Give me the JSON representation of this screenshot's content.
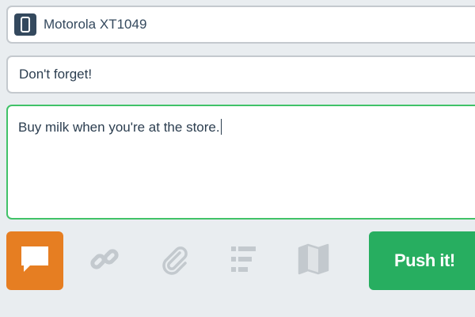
{
  "device": {
    "label": "Motorola XT1049",
    "icon": "phone-icon"
  },
  "title_field": {
    "value": "Don't forget!"
  },
  "body_field": {
    "value": "Buy milk when you're at the store."
  },
  "push_types": [
    {
      "name": "note",
      "icon": "chat-bubble-icon",
      "active": true
    },
    {
      "name": "link",
      "icon": "link-icon",
      "active": false
    },
    {
      "name": "file",
      "icon": "paperclip-icon",
      "active": false
    },
    {
      "name": "list",
      "icon": "list-icon",
      "active": false
    },
    {
      "name": "address",
      "icon": "map-icon",
      "active": false
    }
  ],
  "push_button": {
    "label": "Push it!"
  },
  "colors": {
    "active_type": "#e67e22",
    "push_button": "#27ae60",
    "focus_border": "#40c268",
    "device_icon_bg": "#34495e",
    "inactive_icon": "#c3c9ce"
  }
}
